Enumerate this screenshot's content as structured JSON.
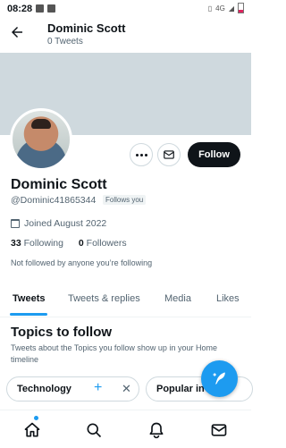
{
  "status_bar": {
    "time": "08:28",
    "network": "4G"
  },
  "header": {
    "name": "Dominic Scott",
    "tweet_count": "0 Tweets"
  },
  "profile": {
    "name": "Dominic Scott",
    "handle": "@Dominic41865344",
    "follows_you": "Follows you",
    "joined": "Joined August 2022",
    "following_count": "33",
    "following_label": "Following",
    "followers_count": "0",
    "followers_label": "Followers",
    "not_followed": "Not followed by anyone you’re following",
    "follow_button": "Follow"
  },
  "tabs": [
    "Tweets",
    "Tweets & replies",
    "Media",
    "Likes"
  ],
  "topics": {
    "title": "Topics to follow",
    "description": "Tweets about the Topics you follow show up in your Home timeline",
    "chips": [
      "Technology",
      "Popular in"
    ]
  },
  "colors": {
    "accent": "#1d9bf0",
    "banner": "#cfd9de",
    "follow_bg": "#0f1419"
  },
  "icons": [
    "back-arrow-icon",
    "more-icon",
    "mail-icon",
    "calendar-icon",
    "plus-icon",
    "close-icon",
    "compose-icon",
    "home-icon",
    "search-icon",
    "notifications-icon",
    "messages-icon"
  ]
}
